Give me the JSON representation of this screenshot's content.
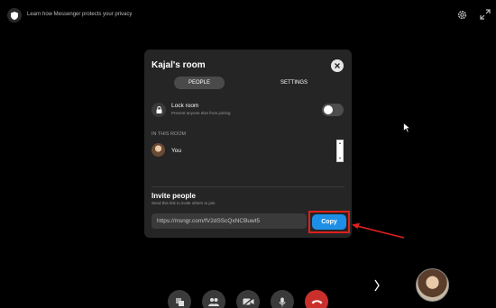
{
  "topbar": {
    "privacy_text": "Learn how Messenger protects your privacy",
    "left_icon": "shield-icon",
    "right_icons": [
      "gear-icon",
      "expand-icon"
    ]
  },
  "modal": {
    "title": "Kajal's room",
    "close_icon": "close-icon",
    "tabs": [
      {
        "label": "PEOPLE",
        "active": true
      },
      {
        "label": "SETTINGS",
        "active": false
      }
    ],
    "lock_room": {
      "label": "Lock room",
      "sublabel": "Prevent anyone else from joining",
      "enabled": false
    },
    "in_room": {
      "section_label": "IN THIS ROOM",
      "people": [
        {
          "name": "You"
        }
      ]
    },
    "invite": {
      "title": "Invite people",
      "subtitle": "Send this link to invite others to join",
      "link_value": "https://msngr.com/fV2dSScQxNCBuwt5",
      "copy_label": "Copy"
    }
  },
  "controls": [
    "share-screen-icon",
    "people-icon",
    "camera-off-icon",
    "microphone-icon",
    "end-call-icon"
  ],
  "colors": {
    "background": "#000000",
    "modal": "#252525",
    "copy_button": "#1e8fe6",
    "highlight": "#e0201c",
    "end_call": "#c9302c"
  }
}
